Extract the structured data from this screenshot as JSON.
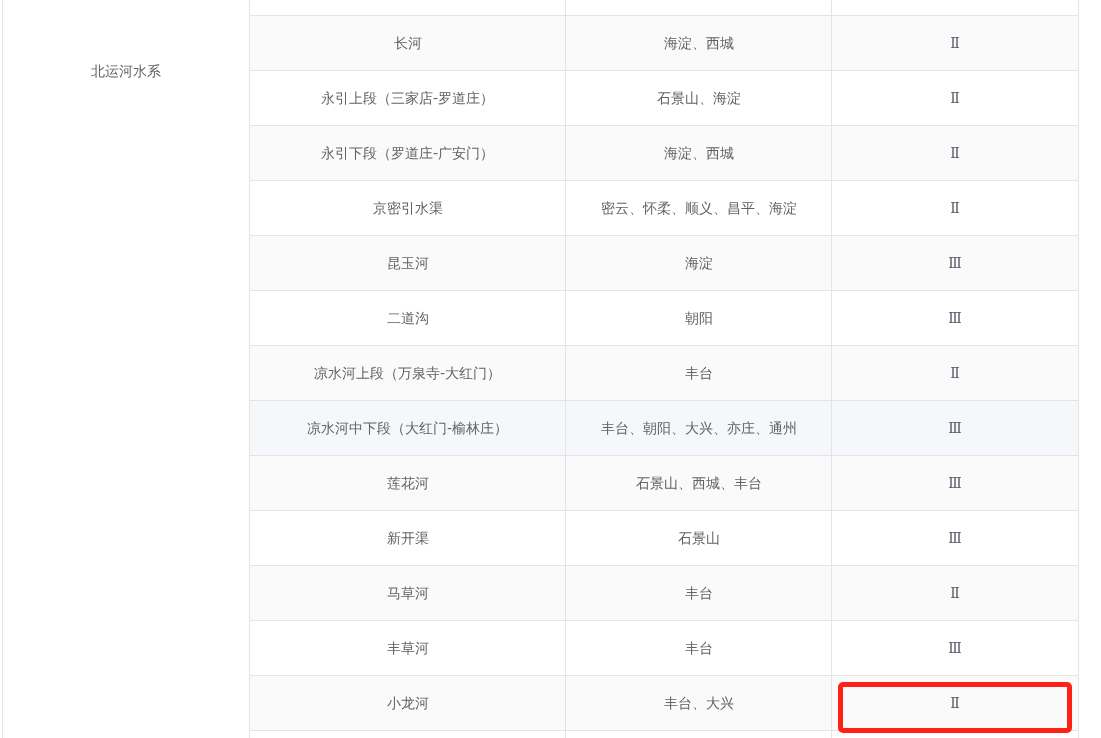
{
  "table": {
    "column_1": "北运河水系",
    "rows": [
      {
        "column_2": "长河",
        "column_3": "海淀、西城",
        "column_4": "Ⅱ",
        "highlighted": false,
        "outlined": false
      },
      {
        "column_2": "永引上段（三家店-罗道庄）",
        "column_3": "石景山、海淀",
        "column_4": "Ⅱ",
        "highlighted": false,
        "outlined": false
      },
      {
        "column_2": "永引下段（罗道庄-广安门）",
        "column_3": "海淀、西城",
        "column_4": "Ⅱ",
        "highlighted": false,
        "outlined": false
      },
      {
        "column_2": "京密引水渠",
        "column_3": "密云、怀柔、顺义、昌平、海淀",
        "column_4": "Ⅱ",
        "highlighted": false,
        "outlined": false
      },
      {
        "column_2": "昆玉河",
        "column_3": "海淀",
        "column_4": "Ⅲ",
        "highlighted": false,
        "outlined": false
      },
      {
        "column_2": "二道沟",
        "column_3": "朝阳",
        "column_4": "Ⅲ",
        "highlighted": false,
        "outlined": false
      },
      {
        "column_2": "凉水河上段（万泉寺-大红门）",
        "column_3": "丰台",
        "column_4": "Ⅱ",
        "highlighted": false,
        "outlined": false
      },
      {
        "column_2": "凉水河中下段（大红门-榆林庄）",
        "column_3": "丰台、朝阳、大兴、亦庄、通州",
        "column_4": "Ⅲ",
        "highlighted": true,
        "outlined": false
      },
      {
        "column_2": "莲花河",
        "column_3": "石景山、西城、丰台",
        "column_4": "Ⅲ",
        "highlighted": false,
        "outlined": false
      },
      {
        "column_2": "新开渠",
        "column_3": "石景山",
        "column_4": "Ⅲ",
        "highlighted": false,
        "outlined": false
      },
      {
        "column_2": "马草河",
        "column_3": "丰台",
        "column_4": "Ⅱ",
        "highlighted": false,
        "outlined": false
      },
      {
        "column_2": "丰草河",
        "column_3": "丰台",
        "column_4": "Ⅲ",
        "highlighted": false,
        "outlined": false
      },
      {
        "column_2": "小龙河",
        "column_3": "丰台、大兴",
        "column_4": "Ⅱ",
        "highlighted": false,
        "outlined": true
      }
    ]
  }
}
